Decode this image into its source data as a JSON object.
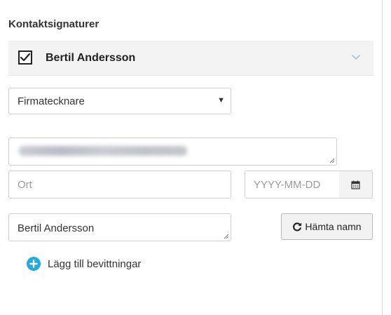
{
  "section": {
    "title": "Kontaktsignaturer"
  },
  "contact": {
    "name": "Bertil Andersson",
    "checked": true
  },
  "role_select": {
    "value": "Firmatecknare"
  },
  "company_field": {
    "value": ""
  },
  "city_field": {
    "placeholder": "Ort"
  },
  "date_field": {
    "placeholder": "YYYY-MM-DD"
  },
  "name_field": {
    "value": "Bertil Andersson"
  },
  "fetch_button": {
    "label": "Hämta namn"
  },
  "add_witness": {
    "label": "Lägg till bevittningar"
  },
  "colors": {
    "accent": "#27a9dd",
    "chevron": "#9cc6dd"
  },
  "icons": {
    "checkbox": "check-icon",
    "collapse": "chevron-down-icon",
    "select": "caret-down-icon",
    "date": "calendar-icon",
    "fetch": "refresh-icon",
    "add": "plus-circle-icon"
  }
}
